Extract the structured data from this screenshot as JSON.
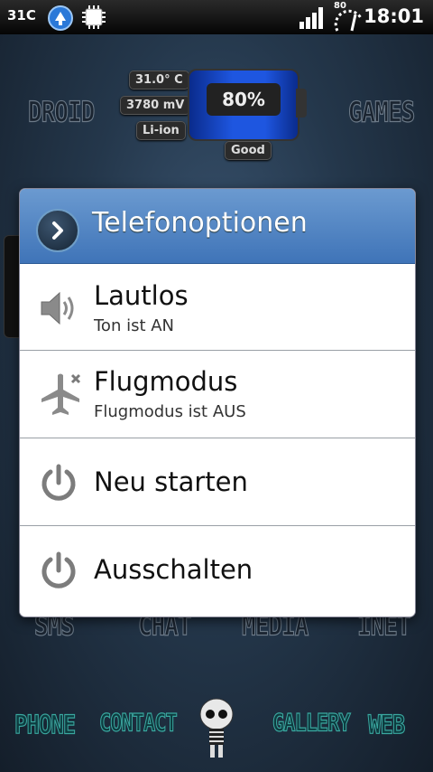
{
  "status_bar": {
    "temperature": "31C",
    "battery_level": "80",
    "time": "18:01",
    "icons": [
      "sync-icon",
      "chip-icon",
      "signal-icon",
      "battery-icon"
    ]
  },
  "homescreen": {
    "battery_widget": {
      "temperature": "31.0° C",
      "voltage": "3780 mV",
      "type": "Li-ion",
      "percent": "80%",
      "health": "Good"
    },
    "top_labels": {
      "left": "DROID",
      "right": "GAMES"
    },
    "middle_labels": [
      "SMS",
      "CHAT",
      "MEDIA",
      "INET"
    ],
    "dock_labels": [
      "PHONE",
      "CONTACT",
      "GALLERY",
      "WEB"
    ]
  },
  "dialog": {
    "title": "Telefonoptionen",
    "options": [
      {
        "title": "Lautlos",
        "subtitle": "Ton ist AN",
        "icon": "speaker-icon"
      },
      {
        "title": "Flugmodus",
        "subtitle": "Flugmodus ist AUS",
        "icon": "airplane-icon"
      },
      {
        "title": "Neu starten",
        "icon": "power-icon"
      },
      {
        "title": "Ausschalten",
        "icon": "power-icon"
      }
    ]
  },
  "colors": {
    "header_blue": "#4a7fc0",
    "background": "#24374b",
    "icon_gray": "#7a7a7a",
    "battery_blue": "#1e56e0"
  }
}
